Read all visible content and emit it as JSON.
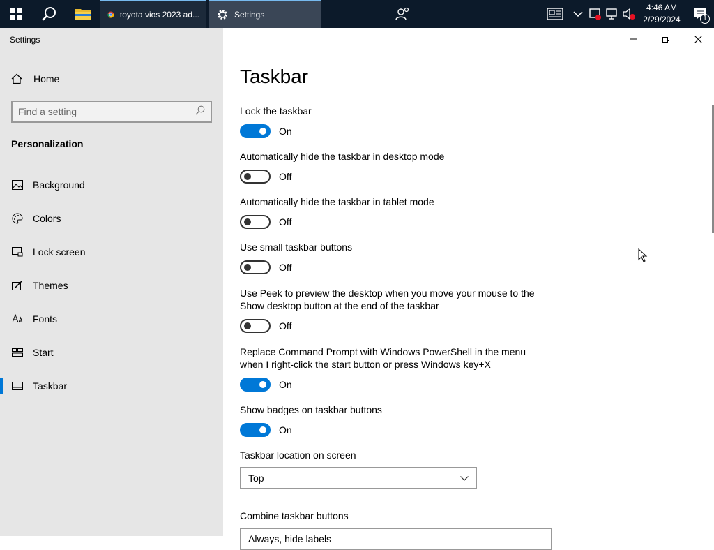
{
  "taskbar": {
    "chrome_tab": "toyota vios 2023 ad...",
    "settings_tab": "Settings",
    "clock_time": "4:46 AM",
    "clock_date": "2/29/2024",
    "notification_count": "1"
  },
  "window": {
    "title": "Settings"
  },
  "sidebar": {
    "home_label": "Home",
    "search_placeholder": "Find a setting",
    "section": "Personalization",
    "items": [
      {
        "label": "Background",
        "icon": "picture-icon"
      },
      {
        "label": "Colors",
        "icon": "palette-icon"
      },
      {
        "label": "Lock screen",
        "icon": "lock-screen-icon"
      },
      {
        "label": "Themes",
        "icon": "themes-icon"
      },
      {
        "label": "Fonts",
        "icon": "fonts-icon"
      },
      {
        "label": "Start",
        "icon": "start-icon"
      },
      {
        "label": "Taskbar",
        "icon": "taskbar-icon"
      }
    ],
    "active": "Taskbar"
  },
  "main": {
    "title": "Taskbar",
    "settings": [
      {
        "label": "Lock the taskbar",
        "state": "On"
      },
      {
        "label": "Automatically hide the taskbar in desktop mode",
        "state": "Off"
      },
      {
        "label": "Automatically hide the taskbar in tablet mode",
        "state": "Off"
      },
      {
        "label": "Use small taskbar buttons",
        "state": "Off"
      },
      {
        "label": "Use Peek to preview the desktop when you move your mouse to the Show desktop button at the end of the taskbar",
        "state": "Off"
      },
      {
        "label": "Replace Command Prompt with Windows PowerShell in the menu when I right-click the start button or press Windows key+X",
        "state": "On"
      },
      {
        "label": "Show badges on taskbar buttons",
        "state": "On"
      }
    ],
    "location_label": "Taskbar location on screen",
    "location_value": "Top",
    "combine_label": "Combine taskbar buttons",
    "combine_value": "Always, hide labels"
  },
  "colors": {
    "accent": "#0078d7",
    "taskbar": "#0c1a2a",
    "sidebar": "#e6e6e6"
  }
}
